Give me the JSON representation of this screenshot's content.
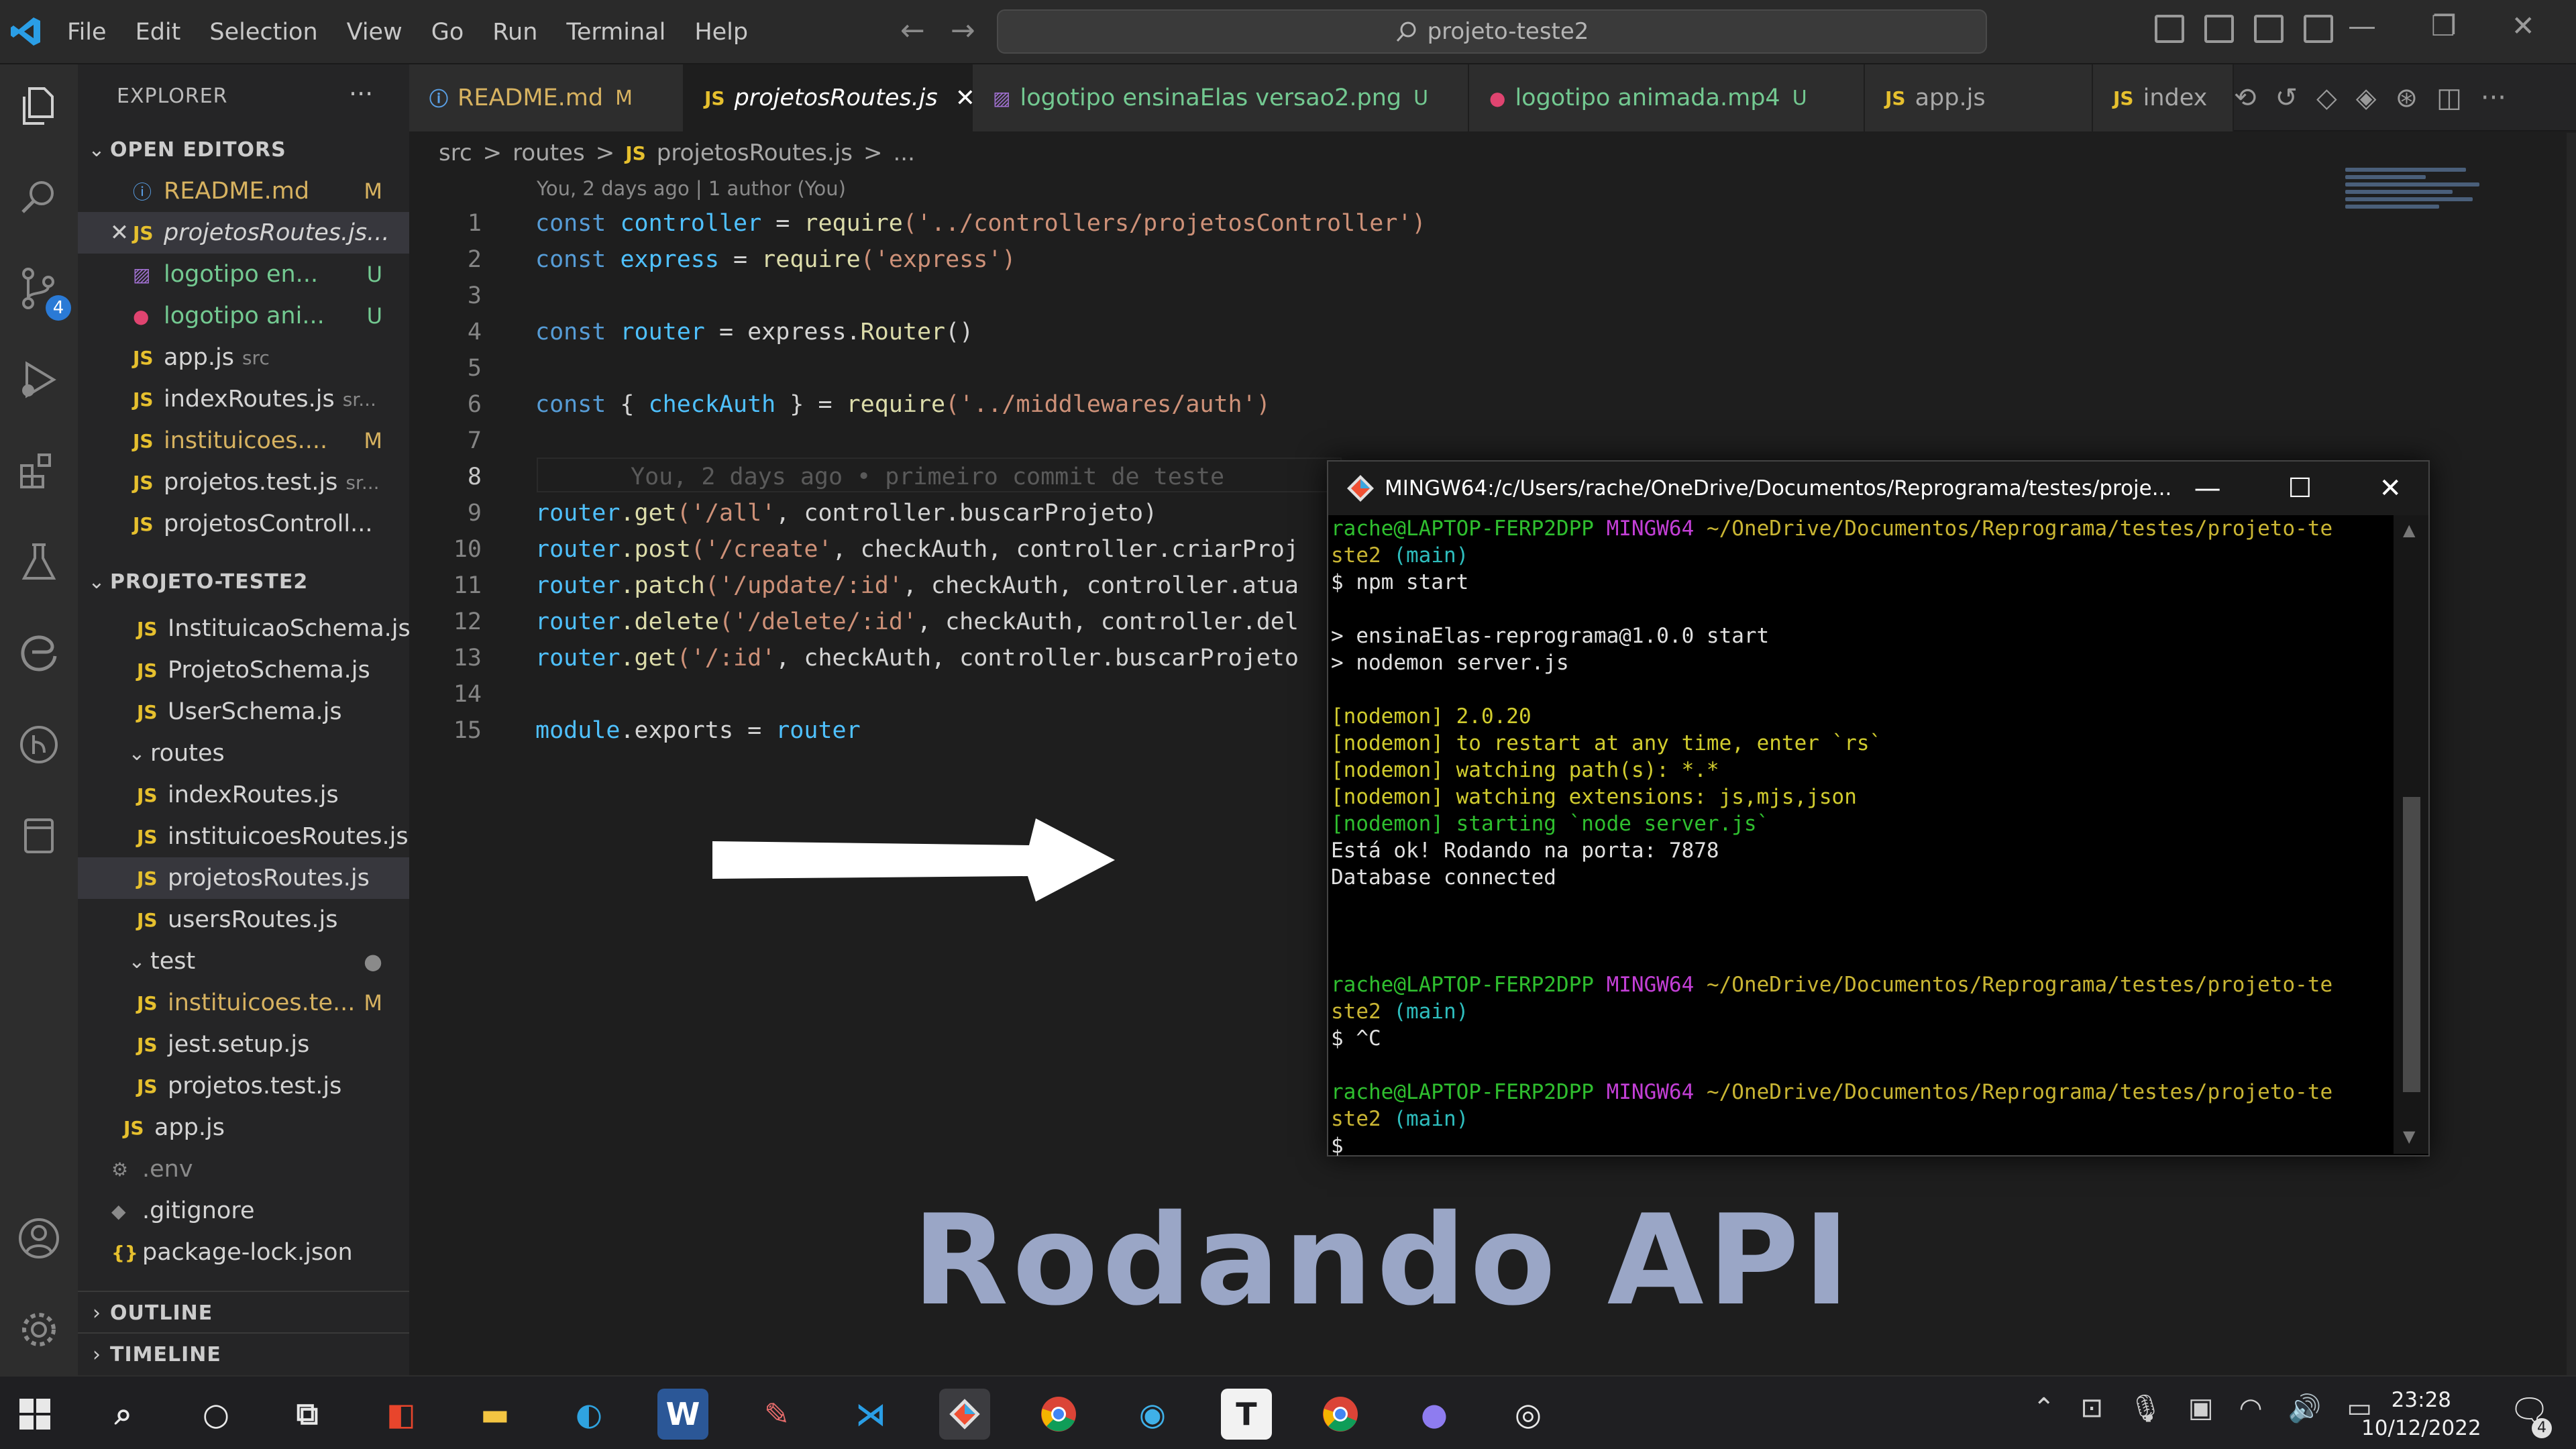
{
  "menu": [
    "File",
    "Edit",
    "Selection",
    "View",
    "Go",
    "Run",
    "Terminal",
    "Help"
  ],
  "command_center": "projeto-teste2",
  "explorer": {
    "title": "EXPLORER",
    "open_editors_label": "OPEN EDITORS",
    "open_editors": [
      {
        "icon": "ⓘ",
        "name": "README.md",
        "status": "M"
      },
      {
        "icon": "JS",
        "name": "projetosRoutes.js...",
        "status": ""
      },
      {
        "icon": "▨",
        "name": "logotipo en...",
        "status": "U"
      },
      {
        "icon": "●",
        "name": "logotipo ani...",
        "status": "U"
      },
      {
        "icon": "JS",
        "name": "app.js",
        "hint": "src",
        "status": ""
      },
      {
        "icon": "JS",
        "name": "indexRoutes.js",
        "hint": "sr...",
        "status": ""
      },
      {
        "icon": "JS",
        "name": "instituicoes....",
        "status": "M"
      },
      {
        "icon": "JS",
        "name": "projetos.test.js",
        "hint": "sr...",
        "status": ""
      },
      {
        "icon": "JS",
        "name": "projetosControll...",
        "status": ""
      }
    ],
    "project_label": "PROJETO-TESTE2",
    "project_tree": [
      {
        "icon": "JS",
        "name": "InstituicaoSchema.js",
        "status": ""
      },
      {
        "icon": "JS",
        "name": "ProjetoSchema.js",
        "status": ""
      },
      {
        "icon": "JS",
        "name": "UserSchema.js",
        "status": ""
      },
      {
        "icon": "",
        "name": "routes",
        "status": ""
      },
      {
        "icon": "JS",
        "name": "indexRoutes.js",
        "status": ""
      },
      {
        "icon": "JS",
        "name": "instituicoesRoutes.js",
        "status": ""
      },
      {
        "icon": "JS",
        "name": "projetosRoutes.js",
        "status": ""
      },
      {
        "icon": "JS",
        "name": "usersRoutes.js",
        "status": ""
      },
      {
        "icon": "",
        "name": "test",
        "status": "●"
      },
      {
        "icon": "JS",
        "name": "instituicoes.te...",
        "status": "M"
      },
      {
        "icon": "JS",
        "name": "jest.setup.js",
        "status": ""
      },
      {
        "icon": "JS",
        "name": "projetos.test.js",
        "status": ""
      },
      {
        "icon": "JS",
        "name": "app.js",
        "status": ""
      },
      {
        "icon": "⚙",
        "name": ".env",
        "status": ""
      },
      {
        "icon": "◆",
        "name": ".gitignore",
        "status": ""
      },
      {
        "icon": "{}",
        "name": "package-lock.json",
        "status": ""
      }
    ],
    "outline_label": "OUTLINE",
    "timeline_label": "TIMELINE"
  },
  "tabs": [
    {
      "icon": "ⓘ",
      "label": "README.md",
      "status": "M"
    },
    {
      "icon": "JS",
      "label": "projetosRoutes.js",
      "close": "✕"
    },
    {
      "icon": "▨",
      "label": "logotipo ensinaElas versao2.png",
      "status": "U"
    },
    {
      "icon": "●",
      "label": "logotipo animada.mp4",
      "status": "U"
    },
    {
      "icon": "JS",
      "label": "app.js",
      "status": ""
    },
    {
      "icon": "JS",
      "label": "index",
      "status": ""
    }
  ],
  "breadcrumb": [
    "src",
    ">",
    "routes",
    ">",
    "JS",
    "projetosRoutes.js",
    ">",
    "..."
  ],
  "blame": "You, 2 days ago | 1 author (You)",
  "code": {
    "line_numbers": [
      "1",
      "2",
      "3",
      "4",
      "5",
      "6",
      "7",
      "8",
      "9",
      "10",
      "11",
      "12",
      "13",
      "14",
      "15"
    ],
    "l1_kw": "const",
    "l1_var": "controller",
    "l1_eq": " = ",
    "l1_fn": "require",
    "l1_str": "('../controllers/projetosController')",
    "l2_kw": "const",
    "l2_var": "express",
    "l2_eq": " = ",
    "l2_fn": "require",
    "l2_str": "('express')",
    "l4_kw": "const",
    "l4_var": "router",
    "l4_eq": " = express.",
    "l4_fn": "Router",
    "l4_rest": "()",
    "l6_kw": "const",
    "l6_b1": " { ",
    "l6_var": "checkAuth",
    "l6_b2": " } = ",
    "l6_fn": "require",
    "l6_str": "('../middlewares/auth')",
    "l8_blame": "You, 2 days ago • primeiro commit de teste",
    "l9_obj": "router",
    "l9_fn": ".get",
    "l9_str": "('/all'",
    "l9_rest": ", controller.buscarProjeto)",
    "l10_obj": "router",
    "l10_fn": ".post",
    "l10_str": "('/create'",
    "l10_rest": ", checkAuth, controller.criarProj",
    "l11_obj": "router",
    "l11_fn": ".patch",
    "l11_str": "('/update/:id'",
    "l11_rest": ", checkAuth, controller.atua",
    "l12_obj": "router",
    "l12_fn": ".delete",
    "l12_str": "('/delete/:id'",
    "l12_rest": ", checkAuth, controller.del",
    "l13_obj": "router",
    "l13_fn": ".get",
    "l13_str": "('/:id'",
    "l13_rest": ", checkAuth, controller.buscarProjeto",
    "l15_obj": "module",
    "l15_mid": ".exports = ",
    "l15_var": "router"
  },
  "terminal": {
    "title": "MINGW64:/c/Users/rache/OneDrive/Documentos/Reprograma/testes/proje...",
    "minimize": "—",
    "maximize": "☐",
    "close": "✕",
    "p1_user": "rache@LAPTOP-FERP2DPP",
    "p1_env": "MINGW64",
    "p1_path": "~/OneDrive/Documentos/Reprograma/testes/projeto-te",
    "p1_cont": "ste2",
    "p1_branch": "(main)",
    "cmd1": "$ npm start",
    "out1": "> ensinaElas-reprograma@1.0.0 start",
    "out2": "> nodemon server.js",
    "nm_tag": "[nodemon]",
    "nm1": " 2.0.20",
    "nm2": " to restart at any time, enter `rs`",
    "nm3": " watching path(s): *.*",
    "nm4": " watching extensions: js,mjs,json",
    "nm5": " starting `node server.js`",
    "ok1": "Está ok! Rodando na porta: 7878",
    "ok2": "Database connected",
    "p2_user": "rache@LAPTOP-FERP2DPP",
    "p2_env": "MINGW64",
    "p2_path": "~/OneDrive/Documentos/Reprograma/testes/projeto-te",
    "p2_cont": "ste2",
    "p2_branch": "(main)",
    "cmd2": "$ ^C",
    "p3_user": "rache@LAPTOP-FERP2DPP",
    "p3_env": "MINGW64",
    "p3_path": "~/OneDrive/Documentos/Reprograma/testes/projeto-te",
    "p3_cont": "ste2",
    "p3_branch": "(main)",
    "cmd3": "$"
  },
  "caption": "Rodando API",
  "taskbar": {
    "clock_time": "23:28",
    "clock_date": "10/12/2022",
    "notification_count": "4"
  },
  "colors": {
    "js_icon": "#e6c02e",
    "git_modified": "#d7b260",
    "git_untracked": "#73c991",
    "terminal_green": "#2fbf2f",
    "terminal_purple": "#c33fd6",
    "terminal_yellow": "#c9b533",
    "caption": "#9aa6c6"
  }
}
